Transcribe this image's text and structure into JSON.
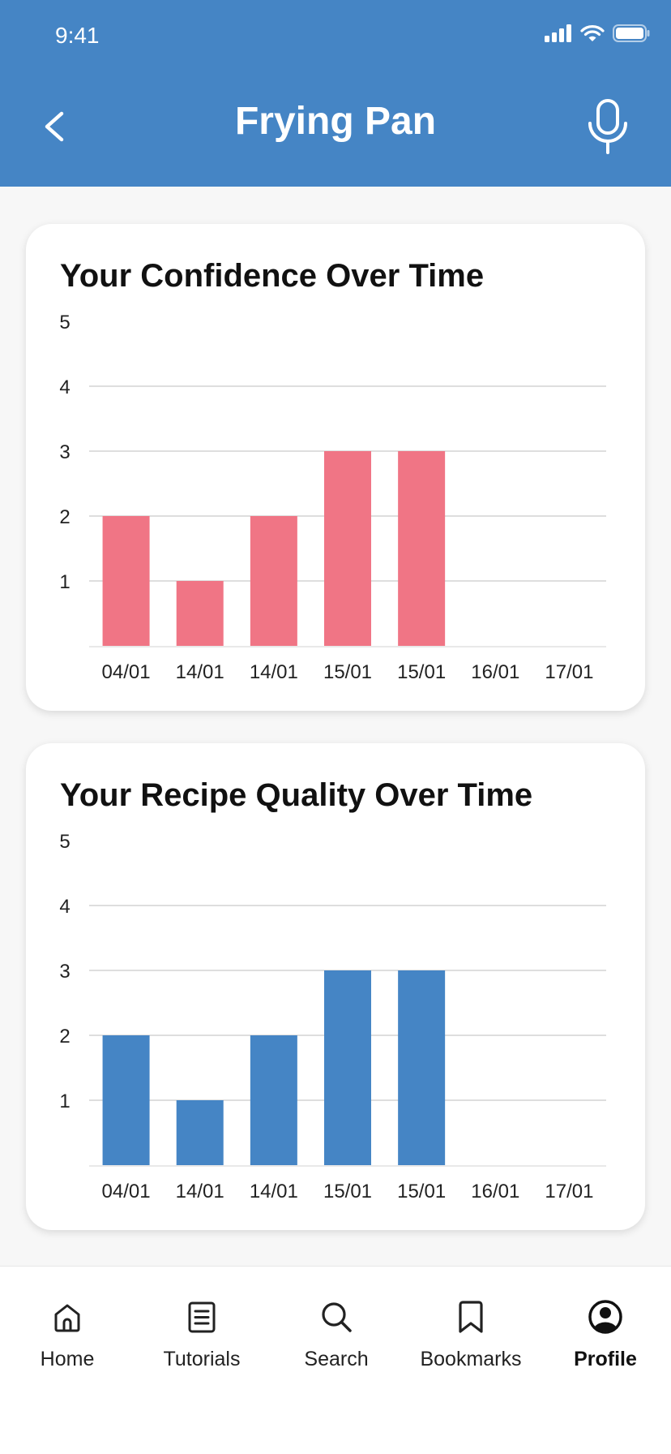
{
  "status_bar": {
    "time": "9:41"
  },
  "header": {
    "title": "Frying Pan",
    "back_icon": "chevron-left-icon",
    "mic_icon": "microphone-icon",
    "color": "#4585c5"
  },
  "charts": [
    {
      "title": "Your Confidence Over Time",
      "bar_color": "#f07585"
    },
    {
      "title": "Your Recipe Quality Over Time",
      "bar_color": "#4585c5"
    }
  ],
  "chart_data": [
    {
      "type": "bar",
      "title": "Your Confidence Over Time",
      "categories": [
        "04/01",
        "14/01",
        "14/01",
        "15/01",
        "15/01",
        "16/01",
        "17/01"
      ],
      "values": [
        2,
        1,
        2,
        3,
        3,
        0,
        0
      ],
      "yticks": [
        1,
        2,
        3,
        4,
        5
      ],
      "ylim": [
        0,
        5
      ],
      "grid": true
    },
    {
      "type": "bar",
      "title": "Your Recipe Quality Over Time",
      "categories": [
        "04/01",
        "14/01",
        "14/01",
        "15/01",
        "15/01",
        "16/01",
        "17/01"
      ],
      "values": [
        2,
        1,
        2,
        3,
        3,
        0,
        0
      ],
      "yticks": [
        1,
        2,
        3,
        4,
        5
      ],
      "ylim": [
        0,
        5
      ],
      "grid": true
    }
  ],
  "tabbar": {
    "items": [
      {
        "label": "Home",
        "icon": "home-icon",
        "active": false
      },
      {
        "label": "Tutorials",
        "icon": "document-icon",
        "active": false
      },
      {
        "label": "Search",
        "icon": "search-icon",
        "active": false
      },
      {
        "label": "Bookmarks",
        "icon": "bookmark-icon",
        "active": false
      },
      {
        "label": "Profile",
        "icon": "profile-icon",
        "active": true
      }
    ]
  }
}
